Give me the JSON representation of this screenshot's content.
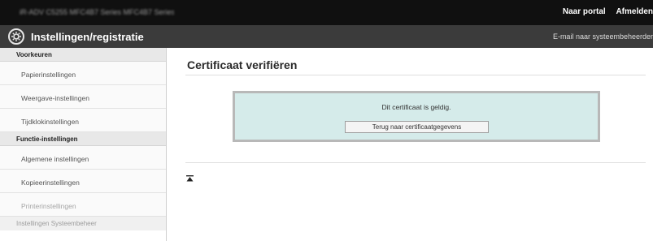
{
  "topbar": {
    "device_label": "iR-ADV C5255   MFC4B7 Series   MFC4B7 Series",
    "portal_link": "Naar portal",
    "logout_link": "Afmelden"
  },
  "header": {
    "app_title": "Instellingen/registratie",
    "email_link": "E-mail naar systeembeheerder"
  },
  "sidebar": {
    "sections": [
      {
        "title": "Voorkeuren",
        "items": [
          {
            "label": "Papierinstellingen"
          },
          {
            "label": "Weergave-instellingen"
          },
          {
            "label": "Tijdklokinstellingen"
          }
        ]
      },
      {
        "title": "Functie-instellingen",
        "items": [
          {
            "label": "Algemene instellingen"
          },
          {
            "label": "Kopieerinstellingen"
          },
          {
            "label": "Printerinstellingen"
          }
        ]
      },
      {
        "title": "Instellingen Systeembeheer",
        "items": []
      }
    ]
  },
  "main": {
    "title": "Certificaat verifiëren",
    "message": "Dit certificaat is geldig.",
    "back_button": "Terug naar certificaatgegevens"
  },
  "colors": {
    "topbar": "#101010",
    "titlebar": "#3b3b3b",
    "message_box": "#d5ebea"
  }
}
